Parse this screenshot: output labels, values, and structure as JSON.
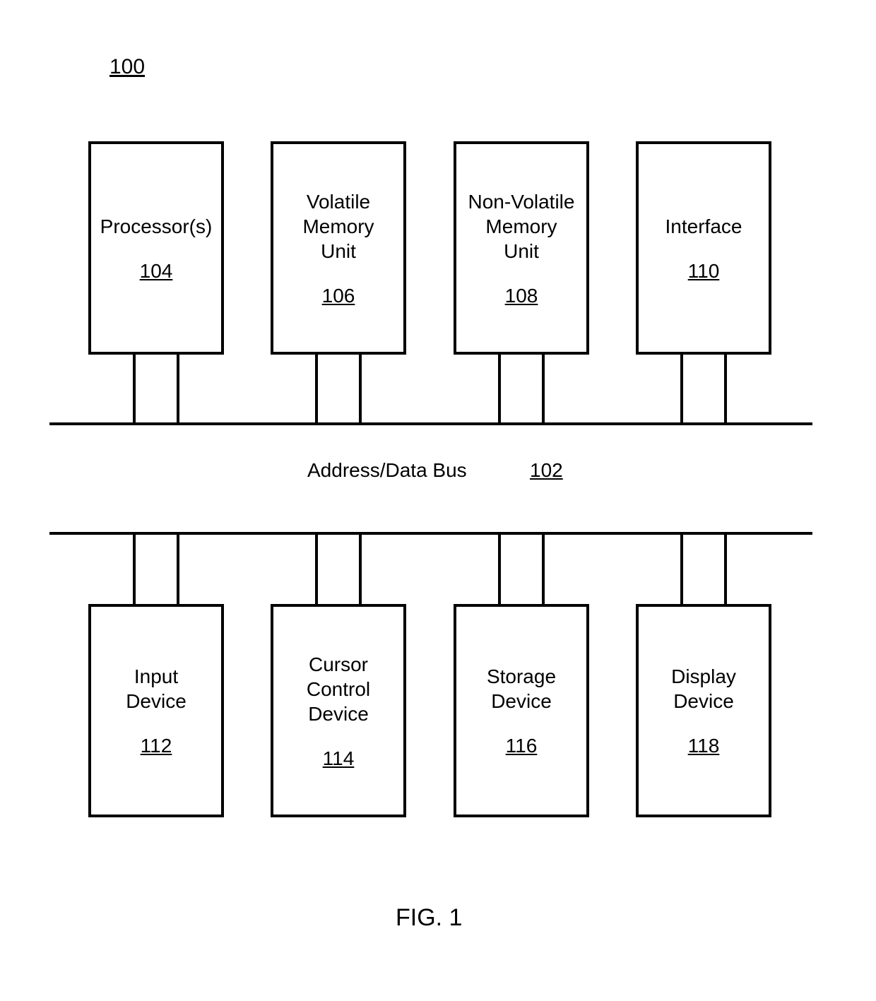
{
  "figure_ref": "100",
  "bus": {
    "label": "Address/Data Bus",
    "ref": "102"
  },
  "boxes": {
    "processor": {
      "label": "Processor(s)",
      "ref": "104"
    },
    "volatile_mem": {
      "label": "Volatile\nMemory\nUnit",
      "ref": "106"
    },
    "nonvolatile_mem": {
      "label": "Non-Volatile\nMemory\nUnit",
      "ref": "108"
    },
    "interface": {
      "label": "Interface",
      "ref": "110"
    },
    "input_dev": {
      "label": "Input\nDevice",
      "ref": "112"
    },
    "cursor_ctrl": {
      "label": "Cursor\nControl\nDevice",
      "ref": "114"
    },
    "storage_dev": {
      "label": "Storage\nDevice",
      "ref": "116"
    },
    "display_dev": {
      "label": "Display\nDevice",
      "ref": "118"
    }
  },
  "caption": "FIG. 1"
}
